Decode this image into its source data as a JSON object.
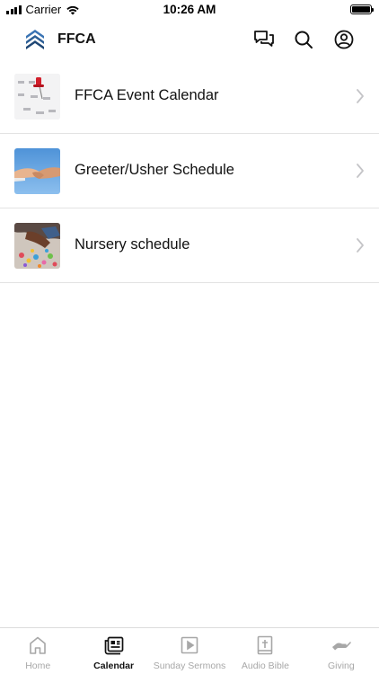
{
  "status": {
    "carrier": "Carrier",
    "time": "10:26 AM"
  },
  "header": {
    "title": "FFCA",
    "logo_icon": "ffca-logo-icon",
    "actions": [
      "chat-icon",
      "search-icon",
      "profile-icon"
    ]
  },
  "items": [
    {
      "label": "FFCA Event Calendar",
      "thumb": "calendar-pushpin-photo"
    },
    {
      "label": "Greeter/Usher Schedule",
      "thumb": "handshake-photo"
    },
    {
      "label": "Nursery schedule",
      "thumb": "child-playing-photo"
    }
  ],
  "tabs": [
    {
      "label": "Home",
      "icon": "home-icon",
      "active": false
    },
    {
      "label": "Calendar",
      "icon": "calendar-news-icon",
      "active": true
    },
    {
      "label": "Sunday Sermons",
      "icon": "play-icon",
      "active": false
    },
    {
      "label": "Audio Bible",
      "icon": "bible-icon",
      "active": false
    },
    {
      "label": "Giving",
      "icon": "giving-hand-icon",
      "active": false
    }
  ],
  "colors": {
    "brand": "#2d5f96",
    "active_tab": "#111111",
    "inactive_tab": "#a7a7a7"
  }
}
